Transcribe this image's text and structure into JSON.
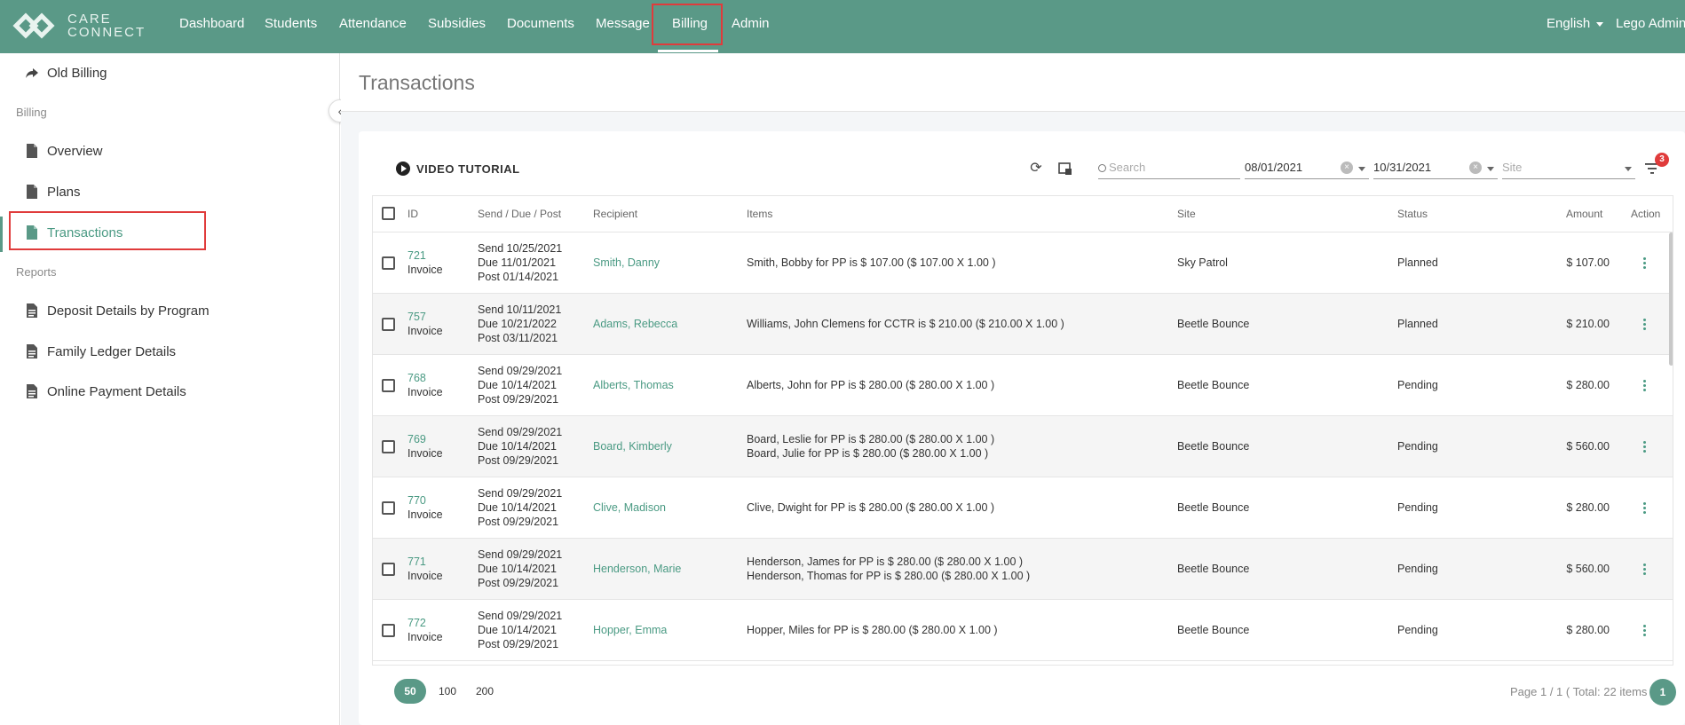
{
  "brand": {
    "line1": "CARE",
    "line2": "CONNECT"
  },
  "nav": {
    "items": [
      "Dashboard",
      "Students",
      "Attendance",
      "Subsidies",
      "Documents",
      "Message",
      "Billing",
      "Admin"
    ],
    "language": "English",
    "user": "Lego Admin"
  },
  "sidebar": {
    "old_billing": "Old Billing",
    "section_billing": "Billing",
    "billing_items": [
      "Overview",
      "Plans",
      "Transactions"
    ],
    "section_reports": "Reports",
    "report_items": [
      "Deposit Details by Program",
      "Family Ledger Details",
      "Online Payment Details"
    ]
  },
  "page": {
    "title": "Transactions"
  },
  "toolbar": {
    "tutorial": "VIDEO TUTORIAL",
    "search_placeholder": "Search",
    "date_from": "08/01/2021",
    "date_to": "10/31/2021",
    "site_placeholder": "Site",
    "filter_count": "3"
  },
  "table": {
    "headers": [
      "ID",
      "Send / Due / Post",
      "Recipient",
      "Items",
      "Site",
      "Status",
      "Amount",
      "Action"
    ],
    "rows": [
      {
        "id": "721",
        "type": "Invoice",
        "send": "Send 10/25/2021",
        "due": "Due 11/01/2021",
        "post": "Post 01/14/2021",
        "recipient": "Smith, Danny",
        "items": [
          "Smith, Bobby for PP is $ 107.00 ($ 107.00 X 1.00 )"
        ],
        "site": "Sky Patrol",
        "status": "Planned",
        "amount": "$ 107.00"
      },
      {
        "id": "757",
        "type": "Invoice",
        "send": "Send 10/11/2021",
        "due": "Due 10/21/2022",
        "post": "Post 03/11/2021",
        "recipient": "Adams, Rebecca",
        "items": [
          "Williams, John Clemens for CCTR is $ 210.00 ($ 210.00 X 1.00 )"
        ],
        "site": "Beetle Bounce",
        "status": "Planned",
        "amount": "$ 210.00"
      },
      {
        "id": "768",
        "type": "Invoice",
        "send": "Send 09/29/2021",
        "due": "Due 10/14/2021",
        "post": "Post 09/29/2021",
        "recipient": "Alberts, Thomas",
        "items": [
          "Alberts, John for PP is $ 280.00 ($ 280.00 X 1.00 )"
        ],
        "site": "Beetle Bounce",
        "status": "Pending",
        "amount": "$ 280.00"
      },
      {
        "id": "769",
        "type": "Invoice",
        "send": "Send 09/29/2021",
        "due": "Due 10/14/2021",
        "post": "Post 09/29/2021",
        "recipient": "Board, Kimberly",
        "items": [
          "Board, Leslie for PP is $ 280.00 ($ 280.00 X 1.00 )",
          "Board, Julie for PP is $ 280.00 ($ 280.00 X 1.00 )"
        ],
        "site": "Beetle Bounce",
        "status": "Pending",
        "amount": "$ 560.00"
      },
      {
        "id": "770",
        "type": "Invoice",
        "send": "Send 09/29/2021",
        "due": "Due 10/14/2021",
        "post": "Post 09/29/2021",
        "recipient": "Clive, Madison",
        "items": [
          "Clive, Dwight for PP is $ 280.00 ($ 280.00 X 1.00 )"
        ],
        "site": "Beetle Bounce",
        "status": "Pending",
        "amount": "$ 280.00"
      },
      {
        "id": "771",
        "type": "Invoice",
        "send": "Send 09/29/2021",
        "due": "Due 10/14/2021",
        "post": "Post 09/29/2021",
        "recipient": "Henderson, Marie",
        "items": [
          "Henderson, James for PP is $ 280.00 ($ 280.00 X 1.00 )",
          "Henderson, Thomas for PP is $ 280.00 ($ 280.00 X 1.00 )"
        ],
        "site": "Beetle Bounce",
        "status": "Pending",
        "amount": "$ 560.00"
      },
      {
        "id": "772",
        "type": "Invoice",
        "send": "Send 09/29/2021",
        "due": "Due 10/14/2021",
        "post": "Post 09/29/2021",
        "recipient": "Hopper, Emma",
        "items": [
          "Hopper, Miles for PP is $ 280.00 ($ 280.00 X 1.00 )"
        ],
        "site": "Beetle Bounce",
        "status": "Pending",
        "amount": "$ 280.00"
      }
    ]
  },
  "pager": {
    "sizes": [
      "50",
      "100",
      "200"
    ],
    "info": "Page 1 / 1 ( Total: 22 items )",
    "current": "1"
  }
}
